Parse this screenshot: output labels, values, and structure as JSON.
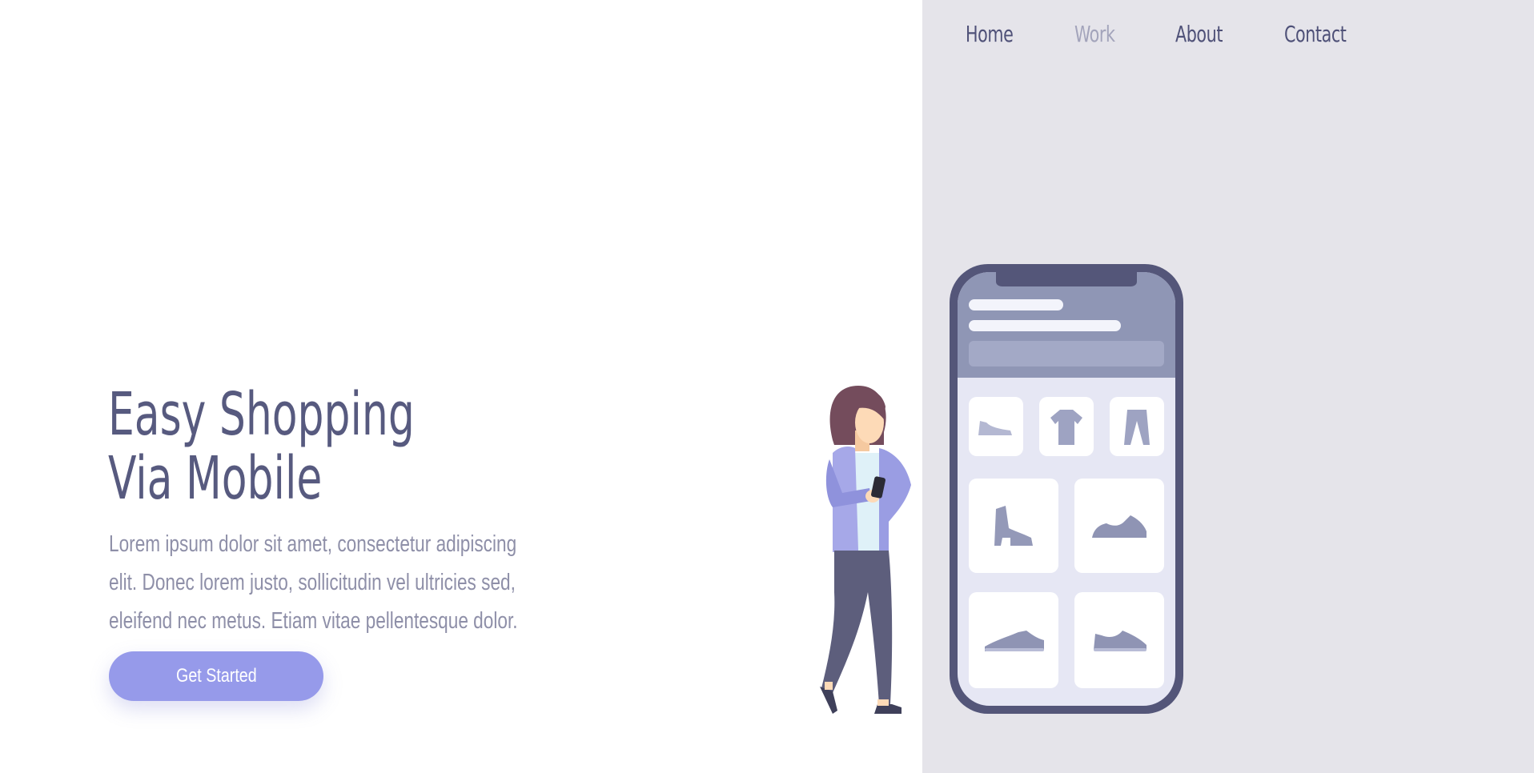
{
  "nav": {
    "items": [
      {
        "label": "Home",
        "active": false
      },
      {
        "label": "Work",
        "active": true
      },
      {
        "label": "About",
        "active": false
      },
      {
        "label": "Contact",
        "active": false
      }
    ]
  },
  "hero": {
    "title_line1": "Easy Shopping",
    "title_line2": "Via Mobile",
    "description": "Lorem ipsum dolor sit amet, consectetur adipiscing elit. Donec lorem justo, sollicitudin vel ultricies sed, eleifend nec metus. Etiam vitae pellentesque dolor.",
    "cta_label": "Get Started"
  },
  "illustration": {
    "figure": "woman-with-phone-illustration",
    "phone": "phone-shop-illustration",
    "categories": [
      "shoe-icon",
      "tshirt-icon",
      "pants-icon"
    ],
    "products": [
      "boot-icon",
      "sneaker-icon",
      "flat-shoe-icon",
      "running-shoe-icon"
    ]
  },
  "colors": {
    "accent": "#969aea",
    "text_dark": "#575a7f",
    "text_muted": "#8e8fa8",
    "panel_bg": "#e5e4ea",
    "phone_frame": "#545679"
  }
}
